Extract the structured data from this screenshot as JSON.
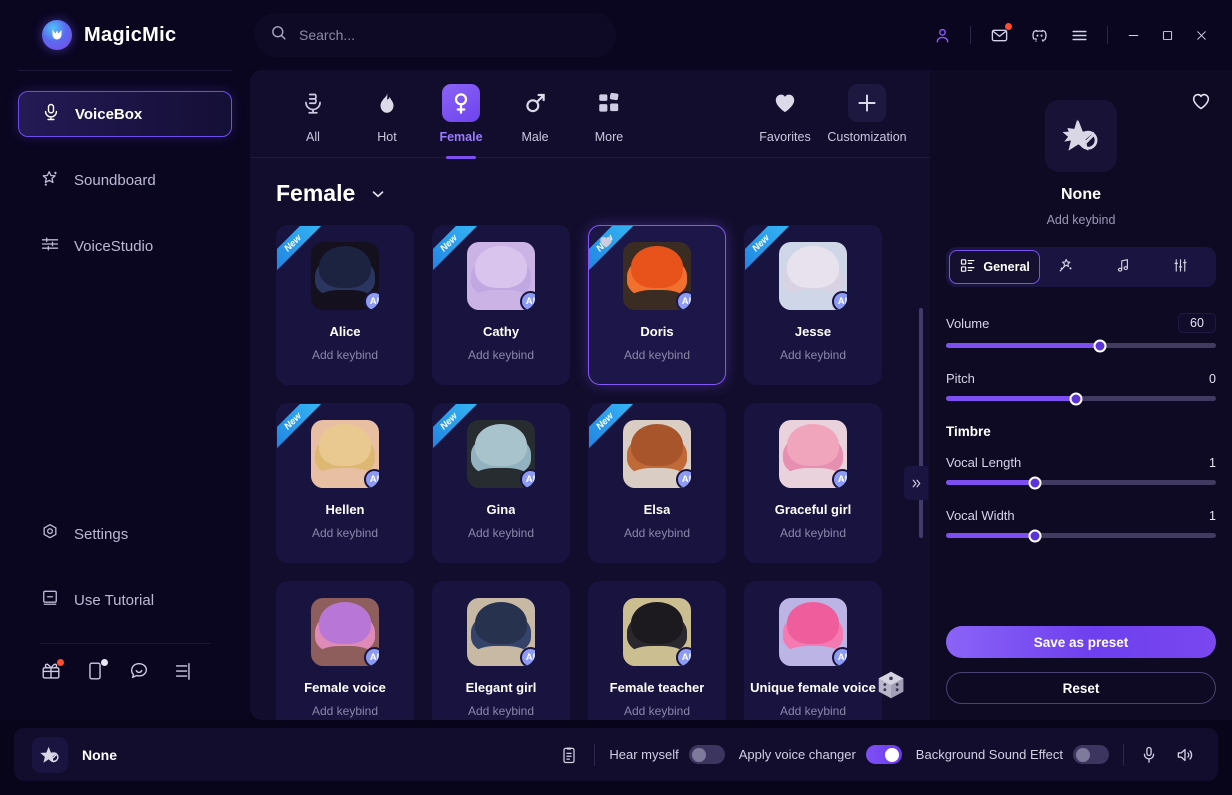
{
  "app": {
    "brand": "MagicMic"
  },
  "search": {
    "placeholder": "Search...",
    "value": ""
  },
  "titlebar": {
    "account": "account-icon",
    "mail": "mail-icon",
    "discord": "discord-icon",
    "menu": "hamburger-menu-icon",
    "minimize": "minimize-button",
    "maximize": "maximize-button",
    "close": "close-button"
  },
  "sidebar": {
    "items": [
      {
        "label": "VoiceBox",
        "icon": "microphone-icon",
        "active": true
      },
      {
        "label": "Soundboard",
        "icon": "magic-star-icon",
        "active": false
      },
      {
        "label": "VoiceStudio",
        "icon": "sliders-icon",
        "active": false
      }
    ],
    "bottom_items": [
      {
        "label": "Settings",
        "icon": "gear-icon"
      },
      {
        "label": "Use Tutorial",
        "icon": "book-icon"
      }
    ],
    "mini_icons": [
      {
        "name": "gift-box-icon",
        "badge": "red"
      },
      {
        "name": "mobile-device-icon",
        "badge": "white"
      },
      {
        "name": "chat-bubble-icon",
        "badge": ""
      },
      {
        "name": "network-icon",
        "badge": ""
      }
    ]
  },
  "categories": [
    {
      "label": "All",
      "icon": "microphone-category-icon",
      "active": false
    },
    {
      "label": "Hot",
      "icon": "flame-icon",
      "active": false
    },
    {
      "label": "Female",
      "icon": "female-symbol-icon",
      "active": true
    },
    {
      "label": "Male",
      "icon": "male-symbol-icon",
      "active": false
    },
    {
      "label": "More",
      "icon": "grid-blocks-icon",
      "active": false
    }
  ],
  "categories_right": [
    {
      "label": "Favorites",
      "icon": "heart-icon",
      "active": false
    },
    {
      "label": "Customization",
      "icon": "plus-icon",
      "active": false
    }
  ],
  "section": {
    "title": "Female",
    "chevron": "chevron-down-icon"
  },
  "voices": [
    {
      "name": "Alice",
      "keybind": "Add keybind",
      "new": true,
      "ai": "AI",
      "selected": false,
      "favorite": false,
      "hair": "#1b2340",
      "hair2": "#2a3560",
      "body": "#15101e",
      "skin": "#f5cfb8"
    },
    {
      "name": "Cathy",
      "keybind": "Add keybind",
      "new": true,
      "ai": "AI",
      "selected": false,
      "favorite": false,
      "hair": "#d9c4ee",
      "hair2": "#c2a8e2",
      "body": "#cbb3e6",
      "skin": "#f6d5bf"
    },
    {
      "name": "Doris",
      "keybind": "Add keybind",
      "new": true,
      "ai": "AI",
      "selected": true,
      "favorite": true,
      "hair": "#e8531c",
      "hair2": "#f2702e",
      "body": "#3a2c22",
      "skin": "#f7d4bb"
    },
    {
      "name": "Jesse",
      "keybind": "Add keybind",
      "new": true,
      "ai": "AI",
      "selected": false,
      "favorite": false,
      "hair": "#e7e2ee",
      "hair2": "#d8d2e2",
      "body": "#cfd6e8",
      "skin": "#f7dcc9"
    },
    {
      "name": "Hellen",
      "keybind": "Add keybind",
      "new": true,
      "ai": "AI",
      "selected": false,
      "favorite": false,
      "hair": "#e9c98f",
      "hair2": "#dcb873",
      "body": "#e8bfa2",
      "skin": "#f7d5bb"
    },
    {
      "name": "Gina",
      "keybind": "Add keybind",
      "new": true,
      "ai": "AI",
      "selected": false,
      "favorite": false,
      "hair": "#a9c3cc",
      "hair2": "#93b2bf",
      "body": "#262c30",
      "skin": "#f3d0bb"
    },
    {
      "name": "Elsa",
      "keybind": "Add keybind",
      "new": true,
      "ai": "AI",
      "selected": false,
      "favorite": false,
      "hair": "#a9552c",
      "hair2": "#c06a38",
      "body": "#d9cdc4",
      "skin": "#f6d2ba"
    },
    {
      "name": "Graceful girl",
      "keybind": "Add keybind",
      "new": false,
      "ai": "AI",
      "selected": false,
      "favorite": false,
      "hair": "#f0a5bd",
      "hair2": "#e78fb0",
      "body": "#ead2dc",
      "skin": "#f8d8c3"
    },
    {
      "name": "Female voice",
      "keybind": "Add keybind",
      "new": false,
      "ai": "AI",
      "selected": false,
      "favorite": false,
      "hair": "#b876d6",
      "hair2": "#e08ab7",
      "body": "#8e5e5c",
      "skin": "#f6d2bb"
    },
    {
      "name": "Elegant girl",
      "keybind": "Add keybind",
      "new": false,
      "ai": "AI",
      "selected": false,
      "favorite": false,
      "hair": "#27324f",
      "hair2": "#35436b",
      "body": "#c7b9a4",
      "skin": "#f4cfb6"
    },
    {
      "name": "Female teacher",
      "keybind": "Add keybind",
      "new": false,
      "ai": "AI",
      "selected": false,
      "favorite": false,
      "hair": "#1c1a1f",
      "hair2": "#2b272f",
      "body": "#cbbe91",
      "skin": "#f5d2ba"
    },
    {
      "name": "Unique female voice",
      "keybind": "Add keybind",
      "new": false,
      "ai": "AI",
      "selected": false,
      "favorite": false,
      "hair": "#ef5d9c",
      "hair2": "#f47ab1",
      "body": "#bcb4e4",
      "skin": "#f8d6c0"
    }
  ],
  "right_panel": {
    "favorite_icon": "heart-outline-icon",
    "avatar_icon": "no-voice-star-icon",
    "name": "None",
    "keybind": "Add keybind",
    "tabs": [
      {
        "label": "General",
        "icon": "grid-general-icon",
        "active": true
      },
      {
        "label": "",
        "icon": "magic-wand-icon",
        "active": false
      },
      {
        "label": "",
        "icon": "music-note-icon",
        "active": false
      },
      {
        "label": "",
        "icon": "equalizer-icon",
        "active": false
      }
    ],
    "sliders": [
      {
        "label": "Volume",
        "value": "60",
        "percent": 57,
        "boxed": true
      },
      {
        "label": "Pitch",
        "value": "0",
        "percent": 48,
        "boxed": false
      }
    ],
    "timbre_title": "Timbre",
    "timbre_sliders": [
      {
        "label": "Vocal Length",
        "value": "1",
        "percent": 33,
        "boxed": false
      },
      {
        "label": "Vocal Width",
        "value": "1",
        "percent": 33,
        "boxed": false
      }
    ],
    "save_label": "Save as preset",
    "reset_label": "Reset"
  },
  "bottom_bar": {
    "avatar_icon": "no-voice-star-icon",
    "voice_name": "None",
    "clipboard_icon": "clipboard-icon",
    "hear_myself": {
      "label": "Hear myself",
      "on": false
    },
    "apply_voice_changer": {
      "label": "Apply voice changer",
      "on": true
    },
    "background_sound_effect": {
      "label": "Background Sound Effect",
      "on": false
    },
    "mic_icon": "microphone-bottom-icon",
    "speaker_icon": "speaker-icon"
  },
  "colors": {
    "accent": "#7c4ff0",
    "accent_light": "#9b7bff",
    "panel": "#120d2c",
    "sidebar": "#0a0620",
    "card": "#191340",
    "new_ribbon": "#2a96ef",
    "notification": "#ff4d2e"
  }
}
